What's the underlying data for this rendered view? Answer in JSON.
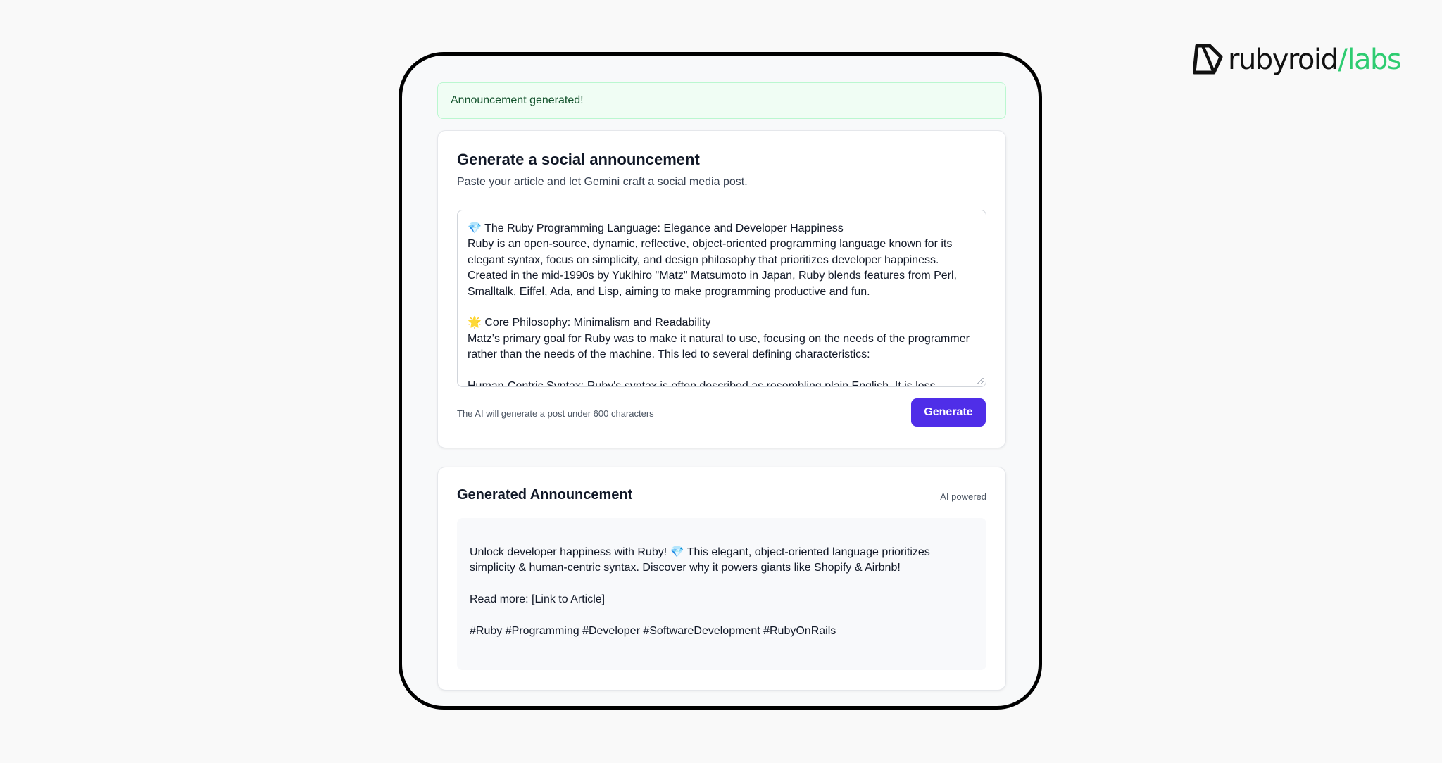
{
  "brand": {
    "name_main": "rubyroid",
    "name_separator": "/",
    "name_accent": "labs",
    "accent_color": "#2ecc71",
    "logo_icon": "rubyroid-gem-icon"
  },
  "alert": {
    "message": "Announcement generated!",
    "status_color": "#14532d"
  },
  "generator": {
    "title": "Generate a social announcement",
    "subtitle": "Paste your article and let Gemini craft a social media post.",
    "article_text": "💎 The Ruby Programming Language: Elegance and Developer Happiness\nRuby is an open-source, dynamic, reflective, object-oriented programming language known for its elegant syntax, focus on simplicity, and design philosophy that prioritizes developer happiness. Created in the mid-1990s by Yukihiro \"Matz\" Matsumoto in Japan, Ruby blends features from Perl, Smalltalk, Eiffel, Ada, and Lisp, aiming to make programming productive and fun.\n\n🌟 Core Philosophy: Minimalism and Readability\nMatz’s primary goal for Ruby was to make it natural to use, focusing on the needs of the programmer rather than the needs of the machine. This led to several defining characteristics:\n\nHuman-Centric Syntax: Ruby's syntax is often described as resembling plain English. It is less",
    "hint": "The AI will generate a post under 600 characters",
    "button_label": "Generate",
    "button_color": "#4f2ee8"
  },
  "output": {
    "title": "Generated Announcement",
    "badge": "AI powered",
    "text": "Unlock developer happiness with Ruby! 💎 This elegant, object-oriented language prioritizes simplicity & human-centric syntax. Discover why it powers giants like Shopify & Airbnb!\n\nRead more: [Link to Article]\n\n#Ruby #Programming #Developer #SoftwareDevelopment #RubyOnRails"
  }
}
